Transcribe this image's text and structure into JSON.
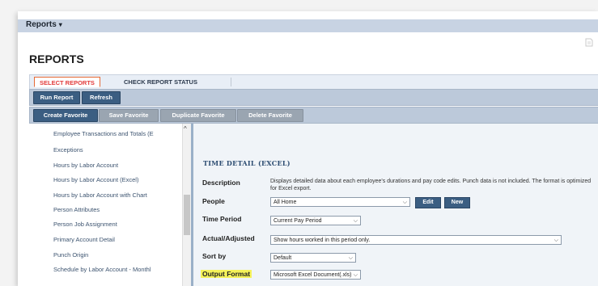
{
  "topbar": {
    "menu_label": "Reports",
    "menu_caret": "▾"
  },
  "page": {
    "title": "REPORTS"
  },
  "tabs": {
    "select_reports": "SELECT REPORTS",
    "check_status": "CHECK REPORT STATUS"
  },
  "toolbar1": {
    "run_report": "Run Report",
    "refresh": "Refresh"
  },
  "toolbar2": {
    "create_favorite": "Create Favorite",
    "save_favorite": "Save Favorite",
    "duplicate_favorite": "Duplicate Favorite",
    "delete_favorite": "Delete Favorite"
  },
  "report_list": [
    "Employee Transactions and Totals (E",
    "Exceptions",
    "Hours by Labor Account",
    "Hours by Labor Account (Excel)",
    "Hours by Labor Account with Chart",
    "Person Attributes",
    "Person Job Assignment",
    "Primary Account Detail",
    "Punch Origin",
    "Schedule by Labor Account - Monthl"
  ],
  "detail": {
    "title": "TIME DETAIL (EXCEL)",
    "labels": {
      "description": "Description",
      "people": "People",
      "time_period": "Time Period",
      "actual_adjusted": "Actual/Adjusted",
      "sort_by": "Sort by",
      "output_format": "Output Format"
    },
    "description_text": "Displays detailed data about each employee's durations and pay code edits. Punch data is not included. The format is optimized for Excel export.",
    "people_value": "All Home",
    "edit_label": "Edit",
    "new_label": "New",
    "time_period_value": "Current Pay Period",
    "actual_adjusted_value": "Show hours worked in this period only.",
    "sort_by_value": "Default",
    "output_format_value": "Microsoft Excel Document(.xls)"
  },
  "icons": {
    "chevron": "⌵",
    "scroll_up": "^"
  },
  "colors": {
    "topbar": "#c8d3e3",
    "dark_button": "#3b5e82",
    "highlight": "#f5f25a",
    "active_tab_text": "#e23b3b"
  }
}
